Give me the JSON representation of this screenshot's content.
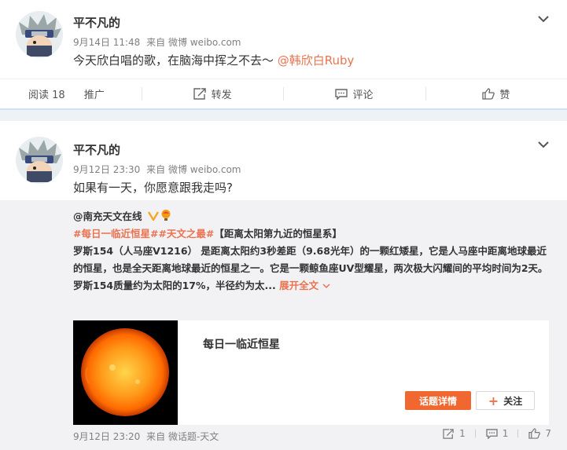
{
  "colors": {
    "accent": "#eb7350",
    "topic_button": "#f0682f",
    "separator": "#cfe3f6",
    "retweet_bg": "#f2f2f5"
  },
  "post1": {
    "username": "平不凡的",
    "time": "9月14日 11:48",
    "source": "来自 微博 weibo.com",
    "text_before": "今天欣白唱的歌，在脑海中挥之不去～ ",
    "mention": "@韩欣白Ruby",
    "actions": {
      "read_label": "阅读",
      "read_count": "18",
      "promote": "推广",
      "repost": "转发",
      "comment": "评论",
      "like": "赞"
    }
  },
  "post2": {
    "username": "平不凡的",
    "time": "9月12日 23:30",
    "source": "来自 微博 weibo.com",
    "text": "如果有一天，你愿意跟我走吗?",
    "retweet": {
      "user": "@南充天文在线",
      "tag1": "#每日一临近恒星#",
      "tag2": "#天文之最#",
      "tag_title": "【距离太阳第九近的恒星系】",
      "para1": "罗斯154（人马座V1216） 是距离太阳约3秒差距（9.68光年）的一颗红矮星，它是人马座中距离地球最近的恒星，也是全天距离地球最近的恒星之一。它是一颗鲸鱼座UV型耀星，两次极大闪耀间的平均时间为2天。",
      "para2": "罗斯154质量约为太阳的17%，半径约为太...",
      "expand": "展开全文",
      "card_title": "每日一临近恒星",
      "topic_button": "话题详情",
      "follow_button": "关注",
      "footer_time": "9月12日 23:20",
      "footer_source": "来自 微话题-天文",
      "reposts": "1",
      "comments": "1",
      "likes": "7"
    }
  }
}
